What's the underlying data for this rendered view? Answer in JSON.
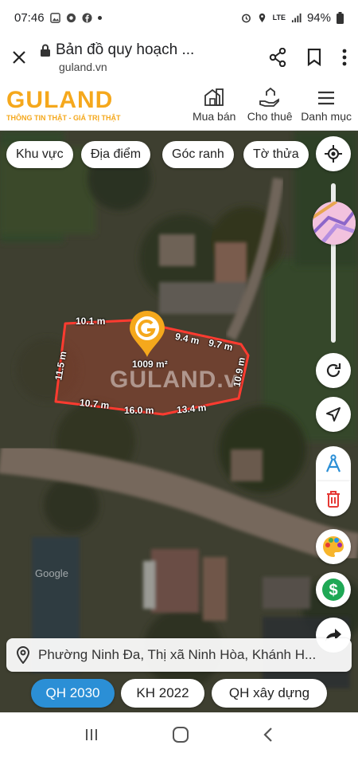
{
  "status_bar": {
    "time": "07:46",
    "network": "LTE",
    "battery": "94%"
  },
  "browser": {
    "title": "Bản đồ quy hoạch ...",
    "url": "guland.vn"
  },
  "site": {
    "logo": "GULAND",
    "tagline": "THÔNG TIN THẬT - GIÁ TRỊ THẬT",
    "nav": [
      {
        "label": "Mua bán",
        "icon": "house-icon"
      },
      {
        "label": "Cho thuê",
        "icon": "hand-house-icon"
      },
      {
        "label": "Danh mục",
        "icon": "menu-icon"
      }
    ],
    "brand_color": "#f5a81c"
  },
  "filters": [
    "Khu vực",
    "Địa điểm",
    "Góc ranh",
    "Tờ thửa"
  ],
  "map": {
    "watermark": "GULAND.VN",
    "watermark_partial": "GULAND.v",
    "google_label": "Google",
    "area": "1009 m²",
    "area_display": "1009 m",
    "measurements": [
      "10.1 m",
      "9.4 m",
      "9.7 m",
      "11.5 m",
      "10.9 m",
      "10.7 m",
      "16.0 m",
      "13.4 m"
    ],
    "plot_outline_color": "#ff3b30"
  },
  "address": "Phường Ninh Đa, Thị xã Ninh Hòa, Khánh H...",
  "plan_buttons": [
    {
      "label": "QH 2030",
      "active": true
    },
    {
      "label": "KH 2022",
      "active": false
    },
    {
      "label": "QH xây dựng",
      "active": false
    }
  ],
  "accent_color": "#2b8fd6"
}
